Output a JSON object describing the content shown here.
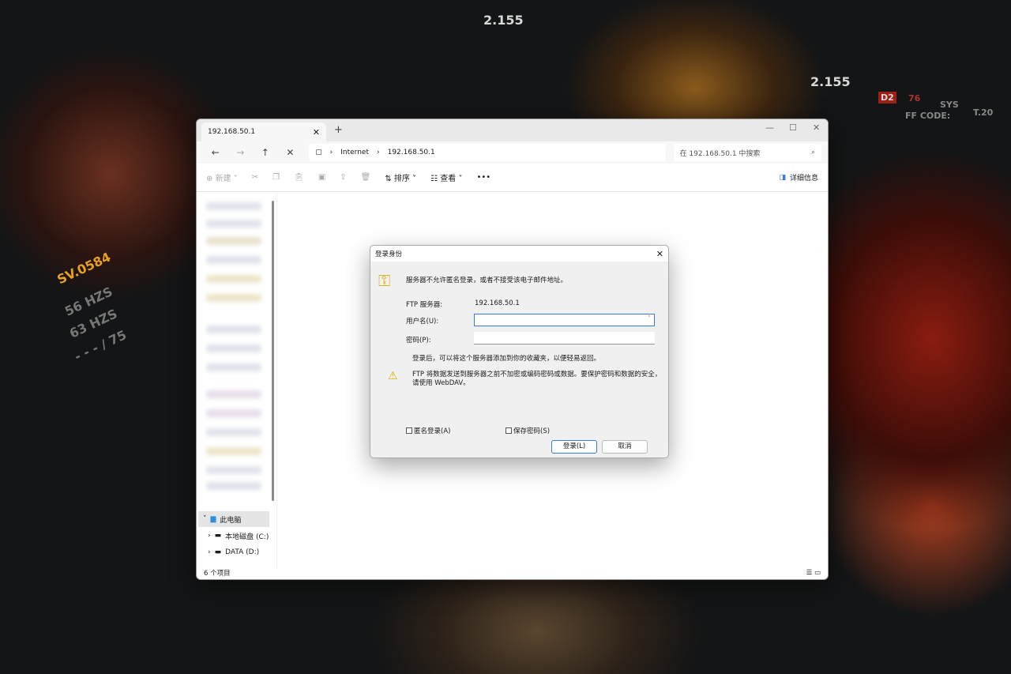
{
  "wallpaper": {
    "hud": [
      "2.155",
      "2.155",
      "SV.0584",
      "56 HZS",
      "63 HZS",
      "- - - / 75",
      "D2",
      "76",
      "SYS",
      "T.20",
      "FF CODE:"
    ]
  },
  "explorer": {
    "tab_title": "192.168.50.1",
    "address": {
      "segments": [
        "Internet",
        "192.168.50.1"
      ]
    },
    "search_placeholder": "在 192.168.50.1 中搜索",
    "toolbar": {
      "new": "新建",
      "sort": "排序",
      "view": "查看",
      "more": "•••",
      "details": "详细信息"
    },
    "sidebar": {
      "this_pc": "此电脑",
      "items": [
        "本地磁盘 (C:)",
        "DATA (D:)"
      ]
    },
    "status": "6 个项目"
  },
  "dialog": {
    "title": "登录身份",
    "message": "服务器不允许匿名登录，或者不接受该电子邮件地址。",
    "ftp_label": "FTP 服务器:",
    "ftp_value": "192.168.50.1",
    "username_label": "用户名(U):",
    "username_value": "",
    "password_label": "密码(P):",
    "password_value": "",
    "hint": "登录后，可以将这个服务器添加到你的收藏夹，以便轻易返回。",
    "warning": "FTP 将数据发送到服务器之前不加密或编码密码或数据。要保护密码和数据的安全，请使用 WebDAV。",
    "anonymous": "匿名登录(A)",
    "anonymous_checked": false,
    "save_password": "保存密码(S)",
    "save_password_checked": false,
    "login": "登录(L)",
    "cancel": "取消"
  }
}
